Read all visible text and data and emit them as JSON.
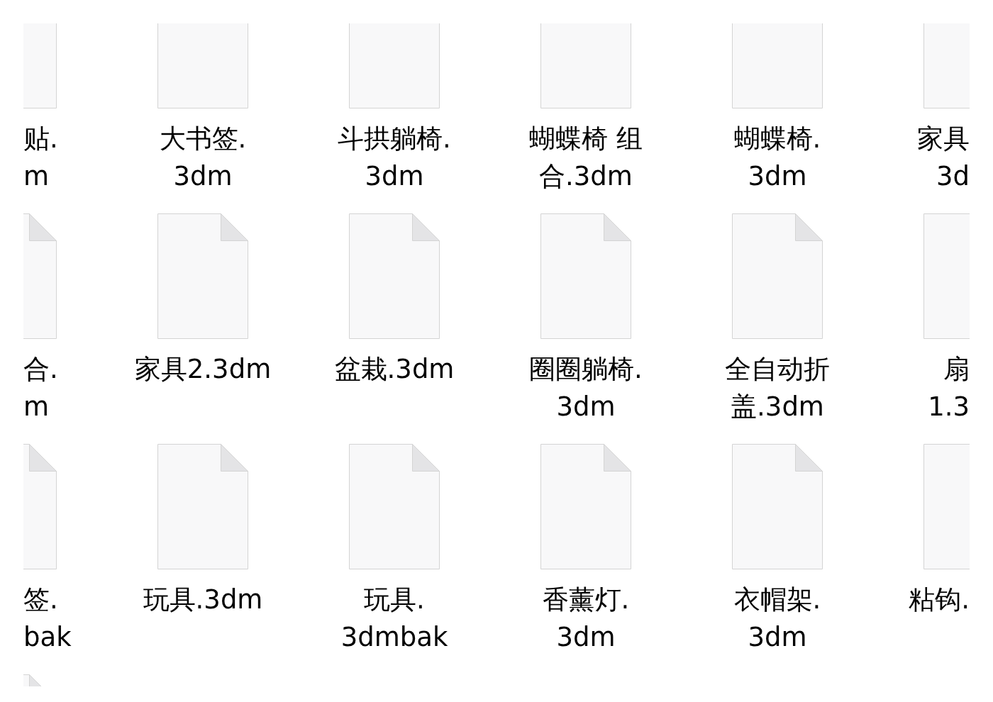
{
  "file_grid": {
    "rows": [
      {
        "items": [
          {
            "kind": "cut_left",
            "lines": [
              "贴.",
              "m"
            ]
          },
          {
            "kind": "full",
            "lines": [
              "大书签.",
              "3dm"
            ]
          },
          {
            "kind": "full",
            "lines": [
              "斗拱躺椅.",
              "3dm"
            ]
          },
          {
            "kind": "full",
            "lines": [
              "蝴蝶椅 组",
              "合.3dm"
            ]
          },
          {
            "kind": "full",
            "lines": [
              "蝴蝶椅.",
              "3dm"
            ]
          },
          {
            "kind": "cut_right",
            "lines": [
              "家具",
              "3d"
            ]
          }
        ]
      },
      {
        "items": [
          {
            "kind": "cut_left",
            "lines": [
              "合.",
              "m"
            ]
          },
          {
            "kind": "full",
            "lines": [
              "家具2.3dm"
            ]
          },
          {
            "kind": "full",
            "lines": [
              "盆栽.3dm"
            ]
          },
          {
            "kind": "full",
            "lines": [
              "圈圈躺椅.",
              "3dm"
            ]
          },
          {
            "kind": "full",
            "lines": [
              "全自动折",
              "盖.3dm"
            ]
          },
          {
            "kind": "cut_right",
            "lines": [
              "扇",
              "1.3"
            ]
          }
        ]
      },
      {
        "items": [
          {
            "kind": "cut_left",
            "lines": [
              "签.",
              "bak"
            ]
          },
          {
            "kind": "full",
            "lines": [
              "玩具.3dm"
            ]
          },
          {
            "kind": "full",
            "lines": [
              "玩具.",
              "3dmbak"
            ]
          },
          {
            "kind": "full",
            "lines": [
              "香薰灯.",
              "3dm"
            ]
          },
          {
            "kind": "full",
            "lines": [
              "衣帽架.",
              "3dm"
            ]
          },
          {
            "kind": "cut_right",
            "lines": [
              "粘钩."
            ]
          }
        ]
      },
      {
        "items": [
          {
            "kind": "cut_left"
          }
        ]
      }
    ]
  }
}
